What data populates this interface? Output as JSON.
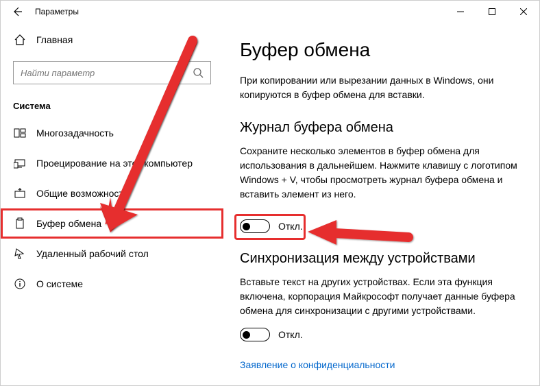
{
  "window": {
    "title": "Параметры"
  },
  "sidebar": {
    "home_label": "Главная",
    "search_placeholder": "Найти параметр",
    "section_label": "Система",
    "items": [
      {
        "label": "Многозадачность"
      },
      {
        "label": "Проецирование на этот компьютер"
      },
      {
        "label": "Общие возможности"
      },
      {
        "label": "Буфер обмена"
      },
      {
        "label": "Удаленный рабочий стол"
      },
      {
        "label": "О системе"
      }
    ]
  },
  "main": {
    "title": "Буфер обмена",
    "intro": "При копировании или вырезании данных в Windows, они копируются в буфер обмена для вставки.",
    "history": {
      "title": "Журнал буфера обмена",
      "desc": "Сохраните несколько элементов в буфер обмена для использования в дальнейшем. Нажмите клавишу с логотипом Windows + V, чтобы просмотреть журнал буфера обмена и вставить элемент из него.",
      "toggle_label": "Откл."
    },
    "sync": {
      "title": "Синхронизация между устройствами",
      "desc": "Вставьте текст на других устройствах. Если эта функция включена, корпорация Майкрософт получает данные буфера обмена для синхронизации с другими устройствами.",
      "toggle_label": "Откл.",
      "link": "Заявление о конфиденциальности"
    }
  }
}
